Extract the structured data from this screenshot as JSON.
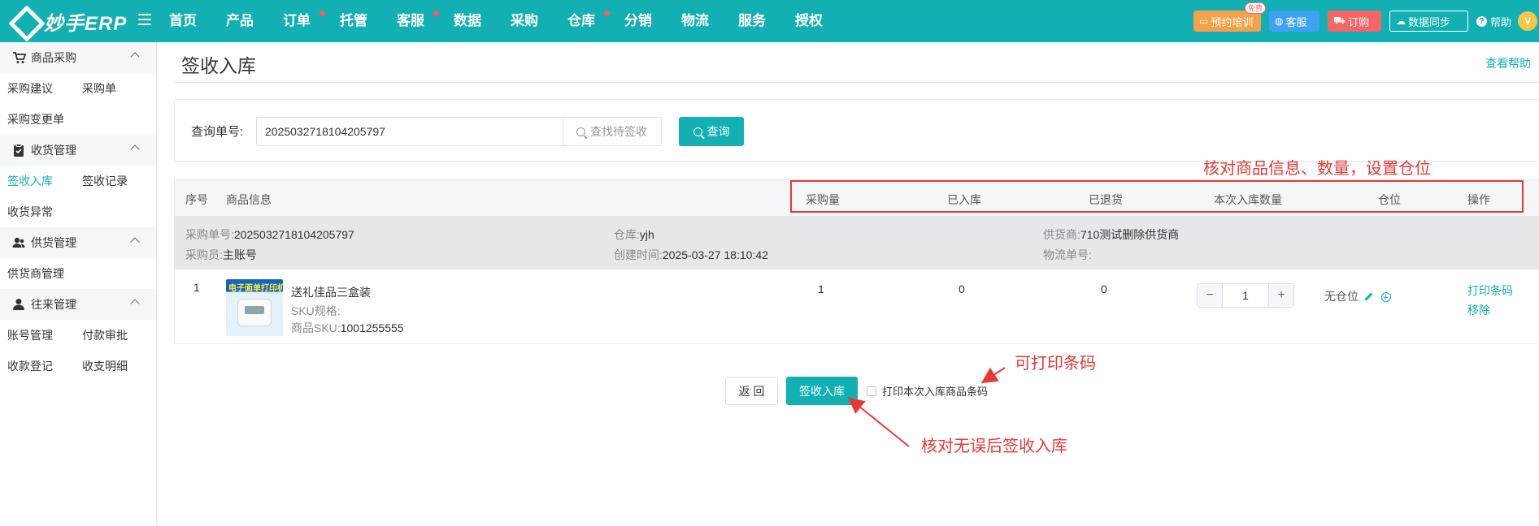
{
  "app": {
    "logo_text": "妙手ERP",
    "brand_color": "#12b0b2",
    "nav": [
      {
        "label": "首页",
        "dot": false
      },
      {
        "label": "产品",
        "dot": false
      },
      {
        "label": "订单",
        "dot": true
      },
      {
        "label": "托管",
        "dot": false
      },
      {
        "label": "客服",
        "dot": true
      },
      {
        "label": "数据",
        "dot": false
      },
      {
        "label": "采购",
        "dot": false
      },
      {
        "label": "仓库",
        "dot": true
      },
      {
        "label": "分销",
        "dot": false
      },
      {
        "label": "物流",
        "dot": false
      },
      {
        "label": "服务",
        "dot": false
      },
      {
        "label": "授权",
        "dot": false
      }
    ],
    "top_actions": {
      "training": "预约培训",
      "training_badge": "免费",
      "service": "客服",
      "order": "订购",
      "sync": "数据同步",
      "help": "帮助",
      "avatar_letter": "V"
    }
  },
  "sidebar": {
    "groups": [
      {
        "title": "商品采购",
        "icon": "cart-icon",
        "items": [
          "采购建议",
          "采购单",
          "采购变更单"
        ]
      },
      {
        "title": "收货管理",
        "icon": "clipboard-icon",
        "items": [
          "签收入库",
          "签收记录",
          "收货异常"
        ]
      },
      {
        "title": "供货管理",
        "icon": "users-icon",
        "items": [
          "供货商管理"
        ]
      },
      {
        "title": "往来管理",
        "icon": "user-icon",
        "items": [
          "账号管理",
          "付款审批",
          "收款登记",
          "收支明细"
        ]
      }
    ],
    "active_item": "签收入库"
  },
  "page": {
    "title": "签收入库",
    "help_link": "查看帮助"
  },
  "search": {
    "label": "查询单号:",
    "value": "2025032718104205797",
    "addon_label": "查找待签收",
    "query_button": "查询"
  },
  "table": {
    "headers": {
      "index": "序号",
      "product": "商品信息",
      "purchase_qty": "采购量",
      "stocked": "已入库",
      "returned": "已退货",
      "this_qty": "本次入库数量",
      "location": "仓位",
      "action": "操作"
    },
    "order": {
      "order_no_label": "采购单号:",
      "order_no": "2025032718104205797",
      "buyer_label": "采购员:",
      "buyer": "主账号",
      "warehouse_label": "仓库:",
      "warehouse": "yjh",
      "created_label": "创建时间:",
      "created": "2025-03-27 18:10:42",
      "supplier_label": "供货商:",
      "supplier": "710测试删除供货商",
      "logistics_label": "物流单号:",
      "logistics": ""
    },
    "row": {
      "index": "1",
      "thumb_caption": "电子面单打印机",
      "name": "送礼佳品三盒装",
      "sku_spec_label": "SKU规格:",
      "sku_label": "商品SKU:",
      "sku": "1001255555",
      "purchase_qty": "1",
      "stocked": "0",
      "returned": "0",
      "this_qty": "1",
      "stepper_minus": "−",
      "stepper_plus": "+",
      "location": "无仓位",
      "print_barcode": "打印条码",
      "remove": "移除"
    }
  },
  "footer": {
    "back_button": "返 回",
    "submit_button": "签收入库",
    "print_checkbox_label": "打印本次入库商品条码"
  },
  "annotations": {
    "check_info": "核对商品信息、数量，设置仓位",
    "can_print": "可打印条码",
    "confirm_submit": "核对无误后签收入库",
    "color": "#e53935"
  }
}
